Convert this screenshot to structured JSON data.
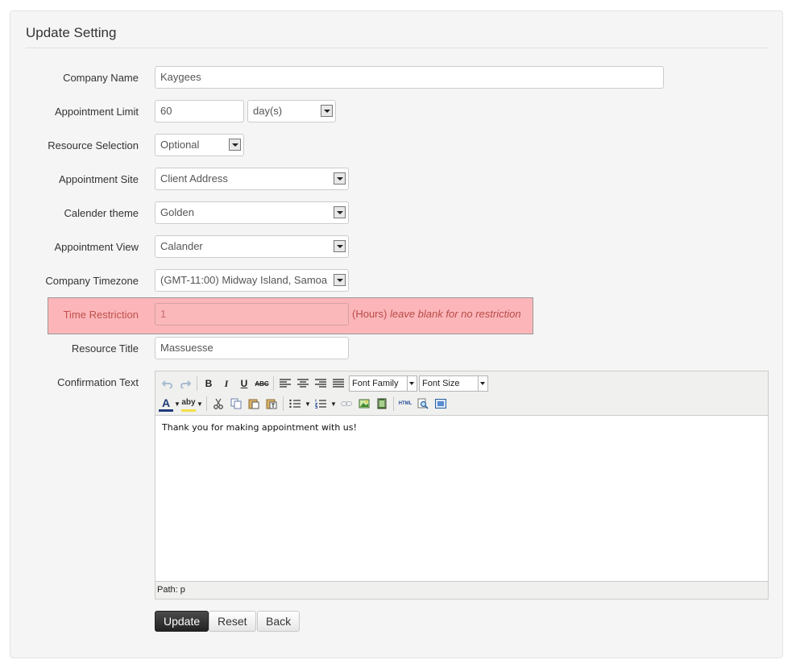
{
  "header": {
    "title": "Update Setting"
  },
  "form": {
    "company_name": {
      "label": "Company Name",
      "value": "Kaygees"
    },
    "appointment_limit": {
      "label": "Appointment Limit",
      "value": "60",
      "unit": "day(s)"
    },
    "resource_selection": {
      "label": "Resource Selection",
      "value": "Optional"
    },
    "appointment_site": {
      "label": "Appointment Site",
      "value": "Client Address"
    },
    "calendar_theme": {
      "label": "Calender theme",
      "value": "Golden"
    },
    "appointment_view": {
      "label": "Appointment View",
      "value": "Calander"
    },
    "company_timezone": {
      "label": "Company Timezone",
      "value": "(GMT-11:00) Midway Island, Samoa"
    },
    "time_restriction": {
      "label": "Time Restriction",
      "value": "1",
      "hint_unit": "(Hours)",
      "hint_text": "leave blank for no restriction"
    },
    "resource_title": {
      "label": "Resource Title",
      "value": "Massuesse"
    },
    "confirmation_text": {
      "label": "Confirmation Text"
    }
  },
  "editor": {
    "font_family_label": "Font Family",
    "font_size_label": "Font Size",
    "content": "Thank you for making appointment with us!",
    "path_label": "Path: p",
    "bold": "B",
    "italic": "I",
    "underline": "U",
    "strike": "ABC",
    "html": "HTML",
    "text_color": "A",
    "bg_color": "aby"
  },
  "buttons": {
    "update": "Update",
    "reset": "Reset",
    "back": "Back"
  },
  "colors": {
    "error_bg": "#fcb6b9",
    "error_text": "#b94a48",
    "primary_button": "#2b2b2b"
  }
}
